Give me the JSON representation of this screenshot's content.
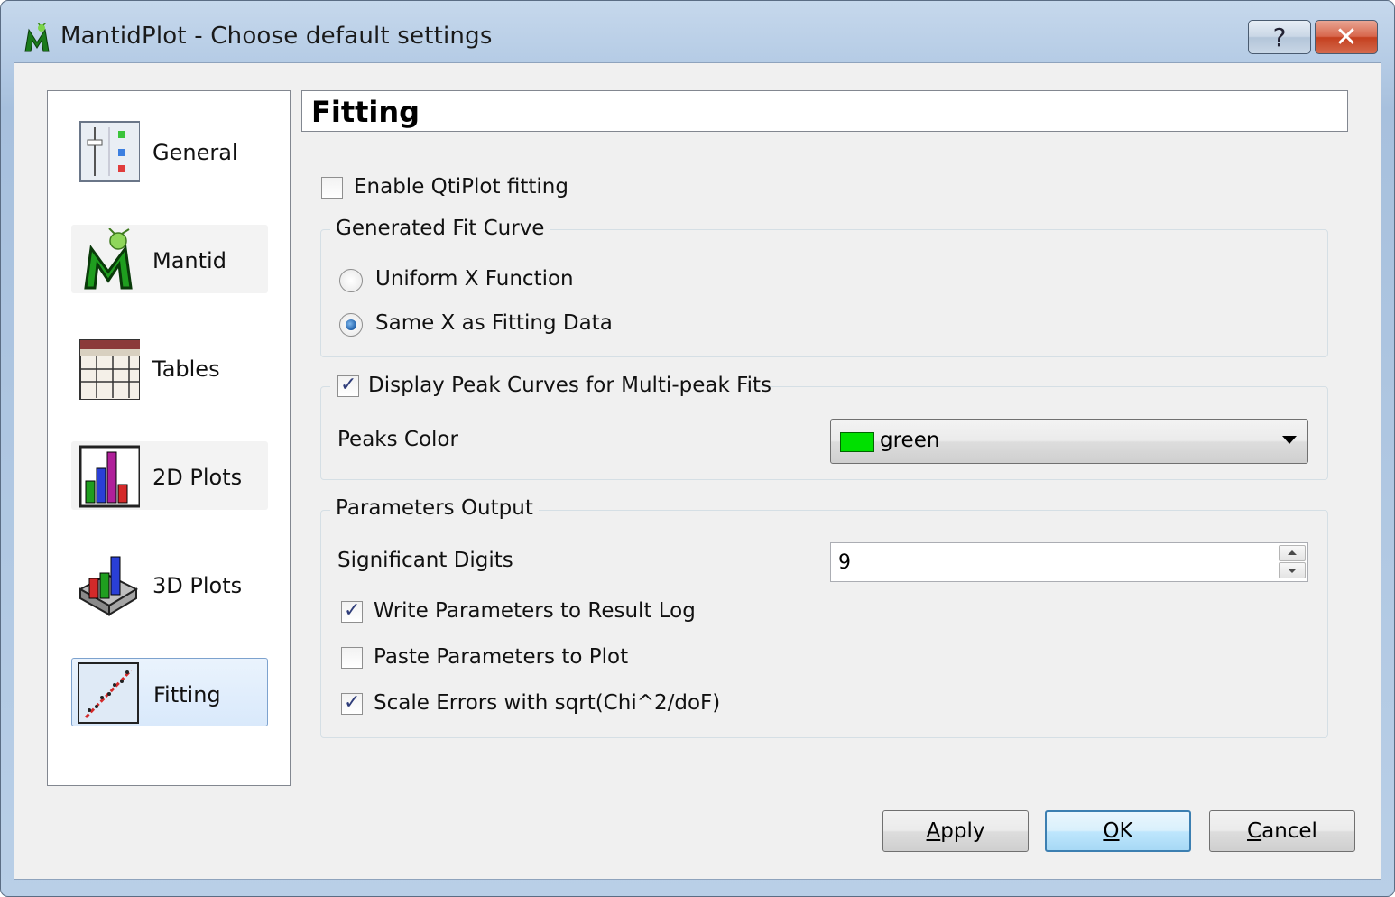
{
  "window": {
    "title": "MantidPlot - Choose default settings",
    "help_label": "?",
    "close_label": "✕"
  },
  "sidebar": {
    "items": [
      {
        "label": "General",
        "icon": "general-settings-icon"
      },
      {
        "label": "Mantid",
        "icon": "mantid-logo-icon"
      },
      {
        "label": "Tables",
        "icon": "table-icon"
      },
      {
        "label": "2D Plots",
        "icon": "bar-chart-icon"
      },
      {
        "label": "3D Plots",
        "icon": "3d-bar-chart-icon"
      },
      {
        "label": "Fitting",
        "icon": "fitting-curve-icon",
        "selected": true
      }
    ]
  },
  "page": {
    "header": "Fitting",
    "enable_qtiplot": {
      "label": "Enable QtiPlot fitting",
      "checked": false
    },
    "fit_curve_group": {
      "title": "Generated Fit Curve",
      "options": [
        {
          "label": "Uniform X Function",
          "selected": false
        },
        {
          "label": "Same X as Fitting Data",
          "selected": true
        }
      ]
    },
    "peak_curves_group": {
      "title": "Display Peak Curves for Multi-peak Fits",
      "checked": true,
      "peaks_color_label": "Peaks Color",
      "peaks_color_value": "green",
      "peaks_color_swatch": "#00e000"
    },
    "params_group": {
      "title": "Parameters Output",
      "sig_digits_label": "Significant Digits",
      "sig_digits_value": "9",
      "write_params": {
        "label": "Write Parameters to Result Log",
        "checked": true
      },
      "paste_params": {
        "label": "Paste Parameters to Plot",
        "checked": false
      },
      "scale_errors": {
        "label": "Scale Errors with sqrt(Chi^2/doF)",
        "checked": true
      }
    }
  },
  "buttons": {
    "apply": {
      "prefix": "",
      "mnemonic": "A",
      "rest": "pply"
    },
    "ok": {
      "prefix": "",
      "mnemonic": "O",
      "rest": "K"
    },
    "cancel": {
      "prefix": "",
      "mnemonic": "C",
      "rest": "ancel"
    }
  }
}
